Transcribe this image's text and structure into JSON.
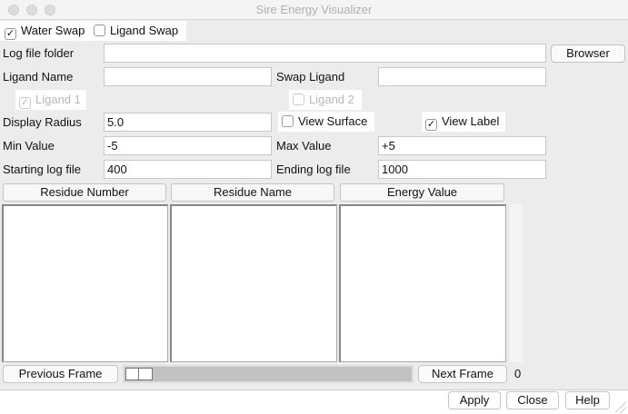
{
  "window": {
    "title": "Sire Energy Visualizer"
  },
  "swap": {
    "water_swap": "Water Swap",
    "water_checked": true,
    "ligand_swap": "Ligand Swap",
    "ligand_checked": false
  },
  "form": {
    "log_folder_label": "Log file folder",
    "log_folder_value": "",
    "browser": "Browser",
    "ligand_name_label": "Ligand Name",
    "ligand_name_value": "",
    "swap_ligand_label": "Swap Ligand",
    "swap_ligand_value": "",
    "ligand1": "Ligand 1",
    "ligand2": "Ligand 2",
    "display_radius_label": "Display Radius",
    "display_radius_value": "5.0",
    "view_surface": "View Surface",
    "view_label": "View Label",
    "min_value_label": "Min Value",
    "min_value": "-5",
    "max_value_label": "Max Value",
    "max_value": "+5",
    "start_log_label": "Starting log file",
    "start_log_value": "400",
    "end_log_label": "Ending log file",
    "end_log_value": "1000"
  },
  "table": {
    "columns": [
      "Residue Number",
      "Residue Name",
      "Energy Value"
    ]
  },
  "frames": {
    "previous": "Previous Frame",
    "next": "Next Frame",
    "current": "0",
    "slider_position": 0
  },
  "footer": {
    "apply": "Apply",
    "close": "Close",
    "help": "Help"
  },
  "check_mark": "✓"
}
